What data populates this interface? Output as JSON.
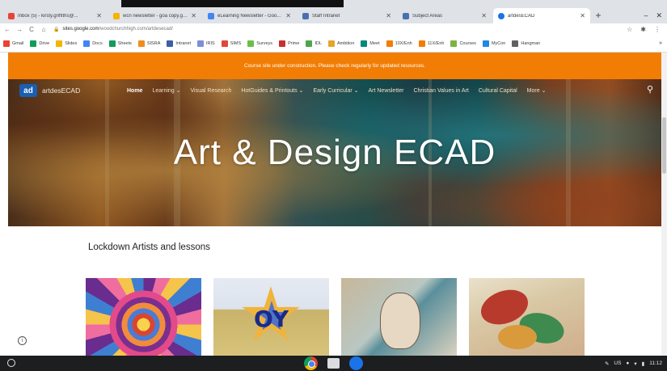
{
  "browser": {
    "tabs": [
      {
        "title": "Inbox (5) - kirsty.griffiths@...",
        "color": "#ea4335",
        "active": false
      },
      {
        "title": "wcn newsletter - goa copy.go...",
        "color": "#f4b400",
        "active": false
      },
      {
        "title": "eLearning Newsletter - Goo...",
        "color": "#4285f4",
        "active": false
      },
      {
        "title": "Staff Intranet",
        "color": "#4a6fb0",
        "active": false
      },
      {
        "title": "Subject Areas",
        "color": "#4a6fb0",
        "active": false
      },
      {
        "title": "artdesECAD",
        "color": "#1a73e8",
        "active": true
      }
    ],
    "new_tab_label": "+",
    "window_controls": [
      "–",
      "✕"
    ],
    "url_host": "sites.google.com",
    "url_path": "/woodchurchhigh.com/artdesecad/",
    "bookmarks": [
      {
        "label": "Gmail",
        "color": "#ea4335"
      },
      {
        "label": "Drive",
        "color": "#0f9d58"
      },
      {
        "label": "Slides",
        "color": "#f4b400"
      },
      {
        "label": "Docs",
        "color": "#4285f4"
      },
      {
        "label": "Sheets",
        "color": "#0f9d58"
      },
      {
        "label": "SISRA",
        "color": "#f28c1e"
      },
      {
        "label": "Intranet",
        "color": "#3b5fa8"
      },
      {
        "label": "IRIS",
        "color": "#7b8fd6"
      },
      {
        "label": "SIMS",
        "color": "#e2463a"
      },
      {
        "label": "Surveys",
        "color": "#6abf4b"
      },
      {
        "label": "Prime",
        "color": "#c9302c"
      },
      {
        "label": "IDL",
        "color": "#4ea64a"
      },
      {
        "label": "Ambition",
        "color": "#e8a32a"
      },
      {
        "label": "Meet",
        "color": "#00897b"
      },
      {
        "label": "10X/Enh",
        "color": "#f57c00"
      },
      {
        "label": "11X/Enh",
        "color": "#f57c00"
      },
      {
        "label": "Courses",
        "color": "#7cb342"
      },
      {
        "label": "MyCon",
        "color": "#1e88e5"
      },
      {
        "label": "Hangman",
        "color": "#616161"
      }
    ],
    "bookmarks_more": "»"
  },
  "site": {
    "notice": "Course site under construction. Please check regularly for updated resources.",
    "logo_text": "ad",
    "site_name": "artdesECAD",
    "nav": [
      {
        "label": "Home",
        "active": true
      },
      {
        "label": "Learning ⌄",
        "active": false
      },
      {
        "label": "Visual Research",
        "active": false
      },
      {
        "label": "HotGuides & Printouts ⌄",
        "active": false
      },
      {
        "label": "Early Curricular ⌄",
        "active": false
      },
      {
        "label": "Art Newsletter",
        "active": false
      },
      {
        "label": "Christian Values in Art",
        "active": false
      },
      {
        "label": "Cultural Capital",
        "active": false
      },
      {
        "label": "More ⌄",
        "active": false
      }
    ],
    "hero_title": "Art & Design ECAD",
    "section_title": "Lockdown Artists and lessons",
    "thumb2_text": "OY"
  },
  "shelf": {
    "locale": "US",
    "time": "11:12"
  }
}
